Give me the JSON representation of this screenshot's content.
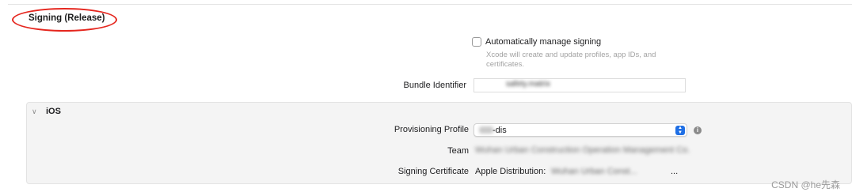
{
  "section": {
    "title": "Signing (Release)"
  },
  "auto_signing": {
    "label": "Automatically manage signing",
    "checked": false,
    "help": "Xcode will create and update profiles, app IDs, and certificates."
  },
  "bundle": {
    "label": "Bundle Identifier",
    "value": "safety.matrix"
  },
  "platform": {
    "name": "iOS"
  },
  "provisioning": {
    "label": "Provisioning Profile",
    "value": "-dis"
  },
  "team": {
    "label": "Team",
    "value": "Wuhan Urban Construction Operation Management Co."
  },
  "certificate": {
    "label": "Signing Certificate",
    "prefix": "Apple Distribution:",
    "redacted": "Wuhan Urban Const...",
    "suffix": "..."
  },
  "watermark": "CSDN @he先森",
  "colors": {
    "annotation_red": "#e5261e",
    "stepper_blue": "#1f6fe5",
    "help_text": "#a3a3a3"
  },
  "icons": {
    "disclosure": "chevron-down-icon",
    "select": "stepper-icon",
    "info": "info-icon"
  }
}
